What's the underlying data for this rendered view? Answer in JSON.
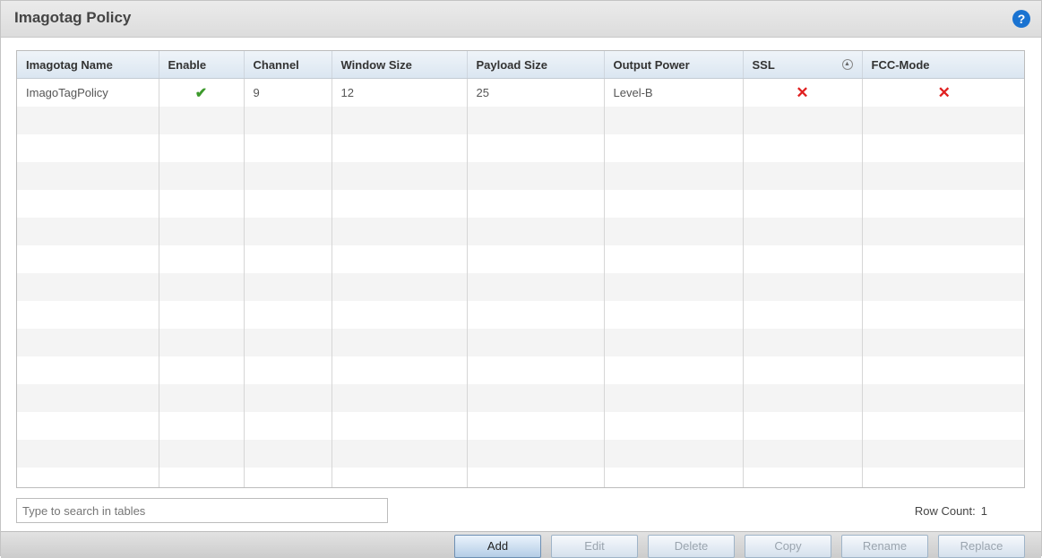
{
  "panel": {
    "title": "Imagotag Policy",
    "help_icon": "question-circle-icon"
  },
  "table": {
    "columns": [
      "Imagotag Name",
      "Enable",
      "Channel",
      "Window Size",
      "Payload Size",
      "Output Power",
      "SSL",
      "FCC-Mode"
    ],
    "sort_indicator_column": "SSL",
    "rows": [
      {
        "name": "ImagoTagPolicy",
        "enable": true,
        "enable_glyph": "✔",
        "channel": "9",
        "window_size": "12",
        "payload_size": "25",
        "output_power": "Level-B",
        "ssl": false,
        "ssl_glyph": "✕",
        "fcc_mode": false,
        "fcc_mode_glyph": "✕"
      }
    ]
  },
  "search": {
    "placeholder": "Type to search in tables",
    "value": ""
  },
  "footer": {
    "row_count_label": "Row Count:",
    "row_count_value": "1"
  },
  "buttons": {
    "add": "Add",
    "edit": "Edit",
    "delete": "Delete",
    "copy": "Copy",
    "rename": "Rename",
    "replace": "Replace"
  },
  "colors": {
    "check": "#3d9a2c",
    "cross": "#e02020",
    "help_icon": "#1a73d1"
  }
}
